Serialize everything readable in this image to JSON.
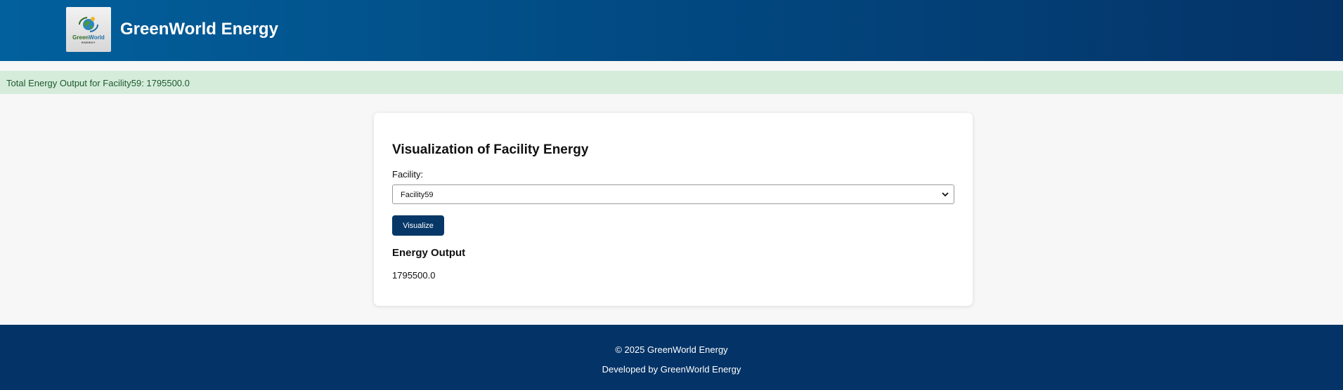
{
  "header": {
    "title": "GreenWorld Energy",
    "logo": {
      "icon": "globe-with-arrows-icon",
      "word_part1": "Green",
      "word_part2": "World",
      "subtext": "ENERGY"
    }
  },
  "alert": {
    "message": "Total Energy Output for Facility59: 1795500.0"
  },
  "card": {
    "title": "Visualization of Facility Energy",
    "facility_label": "Facility:",
    "facility_selected": "Facility59",
    "visualize_label": "Visualize",
    "result_heading": "Energy Output",
    "result_value": "1795500.0"
  },
  "footer": {
    "copyright": "© 2025 GreenWorld Energy",
    "developer": "Developed by GreenWorld Energy"
  },
  "colors": {
    "header_gradient_start": "#02609c",
    "header_gradient_end": "#043367",
    "alert_background": "#d5ecdb",
    "alert_text": "#1d5b2c",
    "button_background": "#063767",
    "footer_background": "#043367",
    "page_background": "#f7f7f7"
  }
}
